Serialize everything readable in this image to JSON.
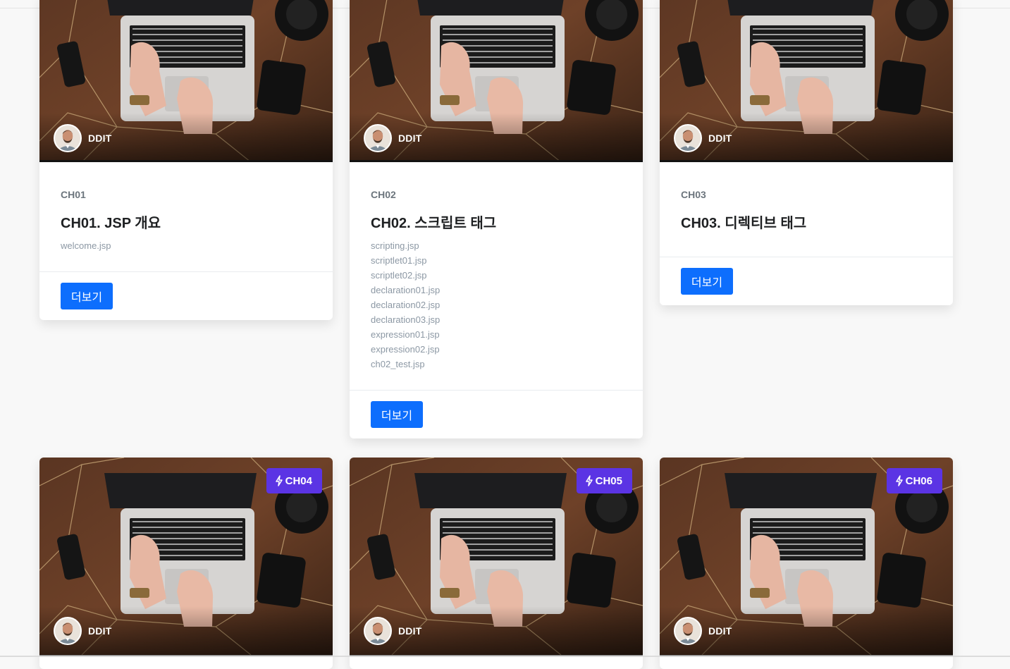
{
  "cards": [
    {
      "author": "DDIT",
      "chapter": "CH01",
      "title": "CH01. JSP 개요",
      "files": [
        "welcome.jsp"
      ],
      "button": "더보기"
    },
    {
      "author": "DDIT",
      "chapter": "CH02",
      "title": "CH02. 스크립트 태그",
      "files": [
        "scripting.jsp",
        "scriptlet01.jsp",
        "scriptlet02.jsp",
        "declaration01.jsp",
        "declaration02.jsp",
        "declaration03.jsp",
        "expression01.jsp",
        "expression02.jsp",
        "ch02_test.jsp"
      ],
      "button": "더보기"
    },
    {
      "author": "DDIT",
      "chapter": "CH03",
      "title": "CH03. 디렉티브 태그",
      "files": [],
      "button": "더보기"
    },
    {
      "author": "DDIT",
      "badge": "CH04",
      "badge_icon": "lightning-icon"
    },
    {
      "author": "DDIT",
      "badge": "CH05",
      "badge_icon": "lightning-icon"
    },
    {
      "author": "DDIT",
      "badge": "CH06",
      "badge_icon": "lightning-icon"
    }
  ],
  "colors": {
    "page_background": "#f8f8f8",
    "button": "#0d6efd",
    "badge": "#5b34e4",
    "title": "#1e2022",
    "muted": "#8c98a4"
  }
}
